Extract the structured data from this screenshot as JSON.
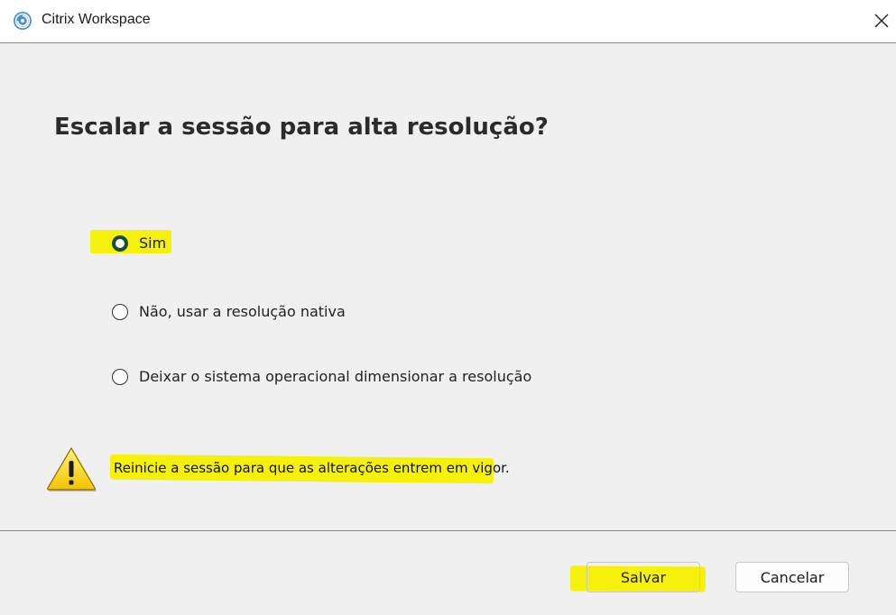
{
  "window": {
    "title": "Citrix Workspace",
    "close_icon": "close-icon"
  },
  "dialog": {
    "heading": "Escalar a sessão para alta resolução?",
    "options": [
      {
        "label": "Sim",
        "selected": true
      },
      {
        "label": "Não, usar a resolução nativa",
        "selected": false
      },
      {
        "label": "Deixar o sistema operacional dimensionar a resolução",
        "selected": false
      }
    ],
    "warning": {
      "icon": "warning-icon",
      "text": "Reinicie a sessão para que as alterações entrem em vigor."
    }
  },
  "footer": {
    "save_label": "Salvar",
    "cancel_label": "Cancelar"
  },
  "colors": {
    "highlight": "#f4f000",
    "selected_radio": "#1e4d2b",
    "window_bg": "#f0f0f0"
  }
}
